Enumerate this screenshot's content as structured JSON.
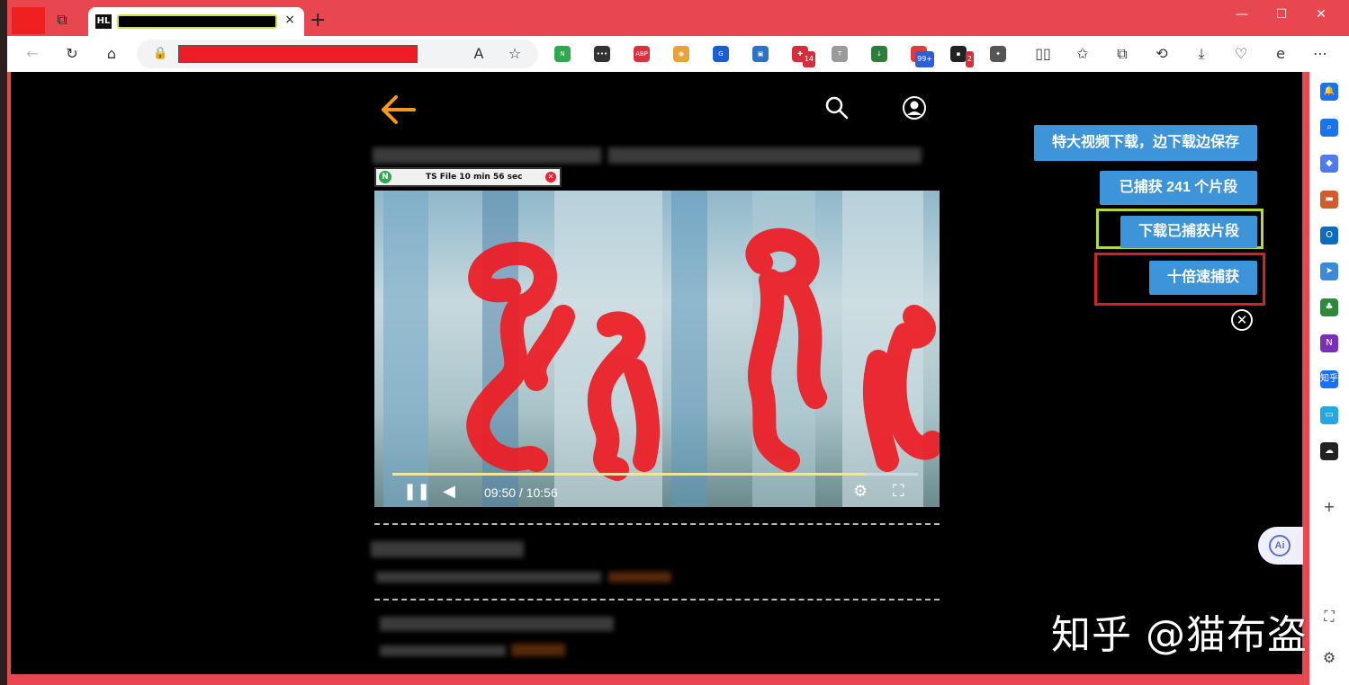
{
  "browser": {
    "tab_fav_label": "HL",
    "tab_close": "×",
    "new_tab": "+",
    "minimize": "—",
    "maximize": "☐",
    "close": "✕",
    "back": "←",
    "reload": "↻",
    "home": "⌂",
    "lock": "🔒",
    "read_aloud": "A",
    "favorite_star": "☆",
    "extensions": [
      {
        "name": "n-icon",
        "color": "#2fa84f",
        "label": "N",
        "badge": ""
      },
      {
        "name": "dots-icon",
        "color": "#333333",
        "label": "•••",
        "badge": ""
      },
      {
        "name": "abp-icon",
        "color": "#d9323a",
        "label": "ABP",
        "badge": ""
      },
      {
        "name": "eyes-icon",
        "color": "#e9a23b",
        "label": "◉",
        "badge": ""
      },
      {
        "name": "g-icon",
        "color": "#1a5fd1",
        "label": "G",
        "badge": ""
      },
      {
        "name": "square-icon",
        "color": "#2a73c8",
        "label": "▣",
        "badge": ""
      },
      {
        "name": "translate-icon",
        "color": "#d62d3a",
        "label": "✚",
        "badge": "14"
      },
      {
        "name": "text-icon",
        "color": "#9a9a9a",
        "label": "T",
        "badge": ""
      },
      {
        "name": "download-ext-icon",
        "color": "#2d7d3a",
        "label": "↓",
        "badge": ""
      },
      {
        "name": "red-ext-icon",
        "color": "#e23b3b",
        "label": "▣",
        "badge": "99+"
      },
      {
        "name": "dark-ext-icon",
        "color": "#222222",
        "label": "▪",
        "badge": "2"
      },
      {
        "name": "puzzle-icon",
        "color": "#555555",
        "label": "✦",
        "badge": ""
      }
    ],
    "toolbar_right": [
      "▯▯",
      "✩",
      "⧉",
      "⟲",
      "⤓",
      "♡",
      "e",
      "⋯"
    ]
  },
  "player": {
    "mini_title": "TS File 10 min 56 sec",
    "mini_logo": "N",
    "mini_close": "✕",
    "time": "09:50 / 10:56",
    "progress": 0.9,
    "pause": "❚❚",
    "volume": "◀",
    "settings": "⚙",
    "fullscreen": "⛶"
  },
  "capture": {
    "big_download_label": "特大视频下载，边下载边保存",
    "captured_label": "已捕获 241 个片段",
    "download_captured_label": "下载已捕获片段",
    "tenx_label": "十倍速捕获",
    "close": "✕"
  },
  "ai_button": "Ai",
  "watermark": "知乎 @猫布盗",
  "sidebar_icons": [
    {
      "name": "bell-icon",
      "color": "#1a73e8",
      "label": "🔔"
    },
    {
      "name": "search-side-icon",
      "color": "#1a73e8",
      "label": "⌕"
    },
    {
      "name": "tag-icon",
      "color": "#4e7be8",
      "label": "◆"
    },
    {
      "name": "toolbox-icon",
      "color": "#d35a2a",
      "label": "▬"
    },
    {
      "name": "outlook-icon",
      "color": "#0f6cbd",
      "label": "O"
    },
    {
      "name": "send-icon",
      "color": "#3a8ad8",
      "label": "➤"
    },
    {
      "name": "tree-icon",
      "color": "#2d8a3a",
      "label": "♣"
    },
    {
      "name": "onenote-icon",
      "color": "#7b2fb5",
      "label": "N"
    },
    {
      "name": "zhihu-icon",
      "color": "#1772f6",
      "label": "知乎"
    },
    {
      "name": "bilibili-icon",
      "color": "#23a8e0",
      "label": "▭"
    },
    {
      "name": "cloud-icon",
      "color": "#222222",
      "label": "☁"
    },
    {
      "name": "add-side-icon",
      "color": "#ffffff",
      "label": "+"
    },
    {
      "name": "screenshot-icon",
      "color": "#ffffff",
      "label": "⛶"
    },
    {
      "name": "settings-side-icon",
      "color": "#ffffff",
      "label": "⚙"
    }
  ]
}
